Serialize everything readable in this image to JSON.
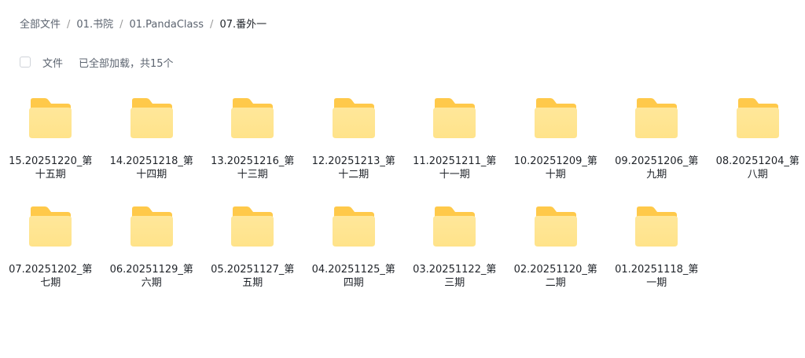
{
  "breadcrumb": {
    "items": [
      "全部文件",
      "01.书院",
      "01.PandaClass",
      "07.番外一"
    ],
    "separator": "/"
  },
  "toolbar": {
    "column_label": "文件",
    "status": "已全部加载，共15个"
  },
  "colors": {
    "folder_back": "#FFC94A",
    "folder_front": "#FFE38A",
    "accent_text": "#1F2329"
  },
  "folders": [
    {
      "name": "15.20251220_第十五期",
      "icon": "folder-icon"
    },
    {
      "name": "14.20251218_第十四期",
      "icon": "folder-icon"
    },
    {
      "name": "13.20251216_第十三期",
      "icon": "folder-icon"
    },
    {
      "name": "12.20251213_第十二期",
      "icon": "folder-icon"
    },
    {
      "name": "11.20251211_第十一期",
      "icon": "folder-icon"
    },
    {
      "name": "10.20251209_第十期",
      "icon": "folder-icon"
    },
    {
      "name": "09.20251206_第九期",
      "icon": "folder-icon"
    },
    {
      "name": "08.20251204_第八期",
      "icon": "folder-icon"
    },
    {
      "name": "07.20251202_第七期",
      "icon": "folder-icon"
    },
    {
      "name": "06.20251129_第六期",
      "icon": "folder-icon"
    },
    {
      "name": "05.20251127_第五期",
      "icon": "folder-icon"
    },
    {
      "name": "04.20251125_第四期",
      "icon": "folder-icon"
    },
    {
      "name": "03.20251122_第三期",
      "icon": "folder-icon"
    },
    {
      "name": "02.20251120_第二期",
      "icon": "folder-icon"
    },
    {
      "name": "01.20251118_第一期",
      "icon": "folder-icon"
    }
  ]
}
